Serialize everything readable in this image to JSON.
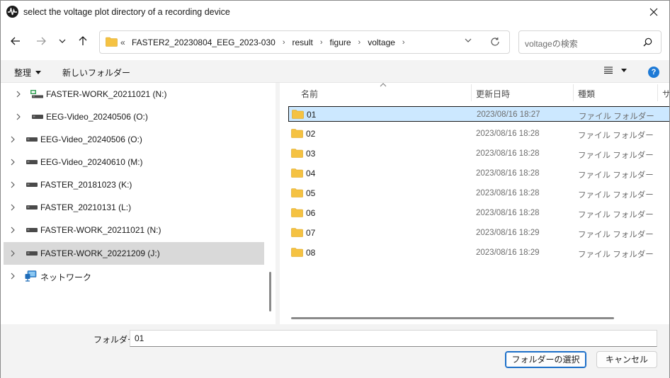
{
  "window": {
    "title": "select the voltage plot directory of a recording device"
  },
  "address": {
    "overflow": "«",
    "crumbs": [
      "FASTER2_20230804_EEG_2023-030",
      "result",
      "figure",
      "voltage"
    ],
    "separator": "›"
  },
  "search": {
    "placeholder": "voltageの検索"
  },
  "toolbar": {
    "organize_label": "整理",
    "new_folder_label": "新しいフォルダー",
    "help_label": "?"
  },
  "nav_tree": [
    {
      "label": "FASTER-WORK_20211021 (N:)",
      "icon": "network-drive-icon",
      "level": 1,
      "selected": false
    },
    {
      "label": "EEG-Video_20240506 (O:)",
      "icon": "drive-icon",
      "level": 1,
      "selected": false
    },
    {
      "label": "EEG-Video_20240506 (O:)",
      "icon": "drive-icon",
      "level": 0,
      "selected": false
    },
    {
      "label": "EEG-Video_20240610 (M:)",
      "icon": "drive-icon",
      "level": 0,
      "selected": false
    },
    {
      "label": "FASTER_20181023 (K:)",
      "icon": "drive-icon",
      "level": 0,
      "selected": false
    },
    {
      "label": "FASTER_20210131 (L:)",
      "icon": "drive-icon",
      "level": 0,
      "selected": false
    },
    {
      "label": "FASTER-WORK_20211021 (N:)",
      "icon": "drive-icon",
      "level": 0,
      "selected": false
    },
    {
      "label": "FASTER-WORK_20221209 (J:)",
      "icon": "drive-icon",
      "level": 0,
      "selected": true
    },
    {
      "label": "ネットワーク",
      "icon": "network-icon",
      "level": 0,
      "selected": false
    }
  ],
  "columns": {
    "name": "名前",
    "date": "更新日時",
    "type": "種類",
    "size": "サ"
  },
  "files": [
    {
      "name": "01",
      "date": "2023/08/16 18:27",
      "type": "ファイル フォルダー",
      "selected": true
    },
    {
      "name": "02",
      "date": "2023/08/16 18:28",
      "type": "ファイル フォルダー",
      "selected": false
    },
    {
      "name": "03",
      "date": "2023/08/16 18:28",
      "type": "ファイル フォルダー",
      "selected": false
    },
    {
      "name": "04",
      "date": "2023/08/16 18:28",
      "type": "ファイル フォルダー",
      "selected": false
    },
    {
      "name": "05",
      "date": "2023/08/16 18:28",
      "type": "ファイル フォルダー",
      "selected": false
    },
    {
      "name": "06",
      "date": "2023/08/16 18:28",
      "type": "ファイル フォルダー",
      "selected": false
    },
    {
      "name": "07",
      "date": "2023/08/16 18:29",
      "type": "ファイル フォルダー",
      "selected": false
    },
    {
      "name": "08",
      "date": "2023/08/16 18:29",
      "type": "ファイル フォルダー",
      "selected": false
    }
  ],
  "footer": {
    "folder_label": "フォルダー:",
    "folder_value": "01",
    "select_button": "フォルダーの選択",
    "cancel_button": "キャンセル"
  },
  "colors": {
    "accent": "#1a6ec8",
    "selection": "#cce8ff",
    "folder": "#f5c242"
  }
}
